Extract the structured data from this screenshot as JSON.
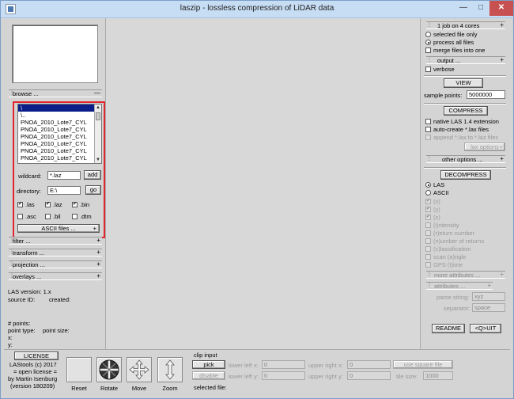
{
  "window": {
    "title": "laszip - lossless compression of LiDAR data"
  },
  "left": {
    "browse_label": "browse ...",
    "files": [
      "\\",
      "\\..",
      "PNOA_2010_Lote7_CYL",
      "PNOA_2010_Lote7_CYL",
      "PNOA_2010_Lote7_CYL",
      "PNOA_2010_Lote7_CYL",
      "PNOA_2010_Lote7_CYL",
      "PNOA_2010_Lote7_CYL",
      "PNOA_2010_Lote7_CYL"
    ],
    "wildcard_label": "wildcard:",
    "wildcard_value": "*.laz",
    "add_label": "add",
    "directory_label": "directory:",
    "directory_value": "E:\\",
    "go_label": "go",
    "ext_las": ".las",
    "ext_laz": ".laz",
    "ext_bin": ".bin",
    "ext_asc": ".asc",
    "ext_bil": ".bil",
    "ext_dtm": ".dtm",
    "ascii_files_label": "ASCII files ...",
    "filter_label": "filter ...",
    "transform_label": "transform ...",
    "projection_label": "projection ...",
    "overlays_label": "overlays ...",
    "las_version": "LAS version: 1.x",
    "source_id": "source ID:",
    "created": "created:",
    "points": "# points:",
    "point_type": "point type:",
    "point_size": "point size:",
    "x_label": "x:",
    "y_label": "y:"
  },
  "right": {
    "jobs_label": "1 job on 4 cores",
    "selected_only": "selected file only",
    "process_all": "process all files",
    "merge": "merge files into one",
    "output_label": "output ...",
    "verbose": "verbose",
    "view_label": "VIEW",
    "sample_points_label": "sample points:",
    "sample_points_value": "5000000",
    "compress_label": "COMPRESS",
    "native_las": "native LAS 1.4 extension",
    "auto_create": "auto-create *.lax files",
    "append_lax": "append *.lax to *.laz files",
    "lax_options": "lax options",
    "other_options": "other options ...",
    "decompress_label": "DECOMPRESS",
    "las": "LAS",
    "ascii": "ASCII",
    "attr_x": "(x)",
    "attr_y": "(y)",
    "attr_z": "(z)",
    "attr_i": "(i)ntensity",
    "attr_r": "(r)eturn number",
    "attr_n": "(n)umber of returns",
    "attr_c": "(c)lassification",
    "attr_a": "scan (a)ngle",
    "attr_t": "GPS (t)ime",
    "more_attributes": "more attributes ...",
    "attributes": "attributes ...",
    "parse_string_label": "parse string:",
    "parse_string_value": "xyz",
    "separator_label": "separator:",
    "separator_value": "space",
    "readme_label": "README",
    "quit_label": "<Q>UIT"
  },
  "bottom": {
    "license_label": "LICENSE",
    "credit1": "LAStools (c) 2017",
    "credit2": "= open license =",
    "credit3": "by Martin Isenburg",
    "credit4": "(version 180209)",
    "reset": "Reset",
    "rotate": "Rotate",
    "move": "Move",
    "zoom": "Zoom",
    "clip_input": "clip input",
    "pick": "pick",
    "disable": "disable",
    "lower_left_x": "lower left x:",
    "lower_left_y": "lower left y:",
    "lower_left_x_value": "0",
    "lower_left_y_value": "0",
    "upper_right_x": "upper right x:",
    "upper_right_y": "upper right y:",
    "upper_right_x_value": "0",
    "upper_right_y_value": "0",
    "use_square_file": "use square file",
    "tile_size_label": "tile size:",
    "tile_size_value": "1000",
    "selected_file": "selected file:"
  }
}
